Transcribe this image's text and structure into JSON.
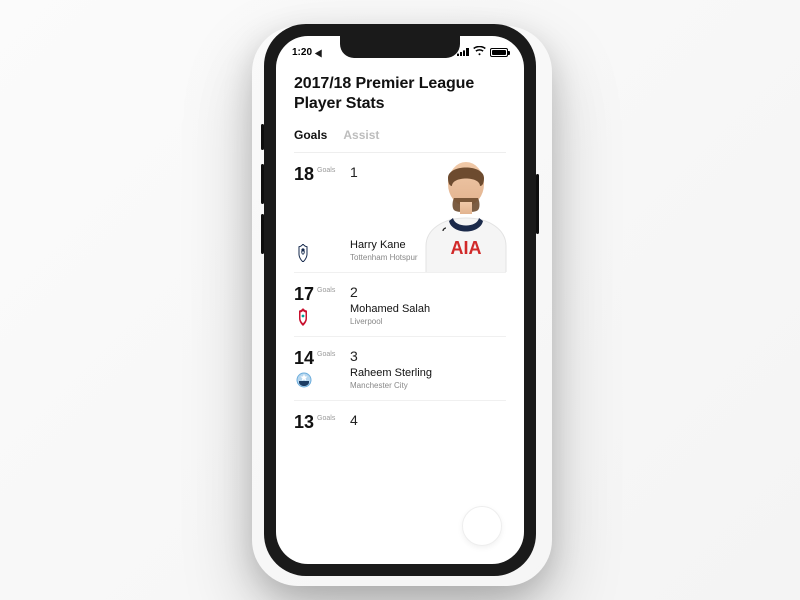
{
  "statusbar": {
    "time": "1:20"
  },
  "header": {
    "title_line1": "2017/18 Premier League",
    "title_line2": "Player Stats"
  },
  "tabs": [
    {
      "id": "goals",
      "label": "Goals",
      "active": true
    },
    {
      "id": "assist",
      "label": "Assist",
      "active": false
    }
  ],
  "stat_label": "Goals",
  "players": [
    {
      "rank": "1",
      "goals": "18",
      "name": "Harry Kane",
      "team": "Tottenham Hotspur",
      "club": "spurs",
      "featured": true,
      "jersey_text": "AIA",
      "jersey_color": "#d12a2a"
    },
    {
      "rank": "2",
      "goals": "17",
      "name": "Mohamed Salah",
      "team": "Liverpool",
      "club": "lfc",
      "featured": false
    },
    {
      "rank": "3",
      "goals": "14",
      "name": "Raheem Sterling",
      "team": "Manchester City",
      "club": "mcfc",
      "featured": false
    },
    {
      "rank": "4",
      "goals": "13",
      "name": "",
      "team": "",
      "club": "",
      "featured": false
    }
  ]
}
